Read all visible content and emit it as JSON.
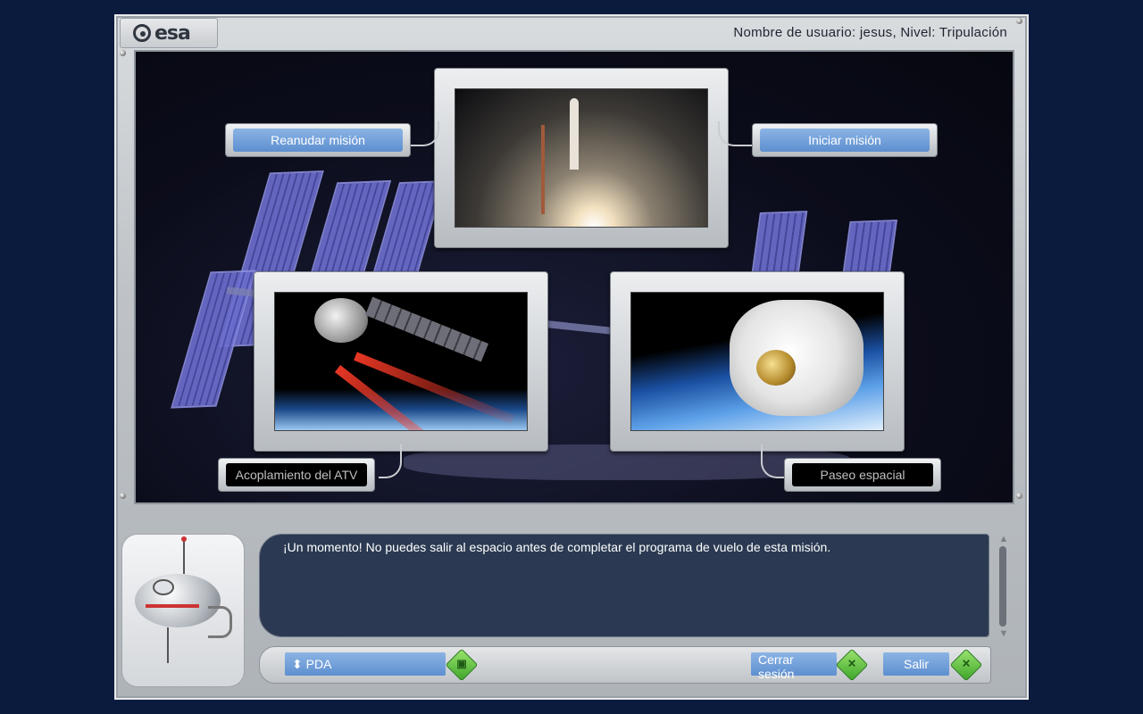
{
  "header": {
    "logo_text": "esa",
    "user_info": "Nombre de usuario: jesus, Nivel: Tripulación"
  },
  "missions": {
    "resume_label": "Reanudar misión",
    "start_label": "Iniciar misión",
    "atv_label": "Acoplamiento del ATV",
    "spacewalk_label": "Paseo espacial"
  },
  "message": {
    "text": "¡Un momento! No puedes salir al espacio antes de completar el programa de vuelo de esta misión."
  },
  "controls": {
    "pda_label": "PDA",
    "pda_arrow": "⬍",
    "logout_label": "Cerrar sesión",
    "exit_label": "Salir"
  },
  "colors": {
    "page_bg": "#0b1b3e",
    "button_blue": "#6c9bd8",
    "message_bg": "#2b3a52",
    "go_green": "#5cc23e"
  }
}
